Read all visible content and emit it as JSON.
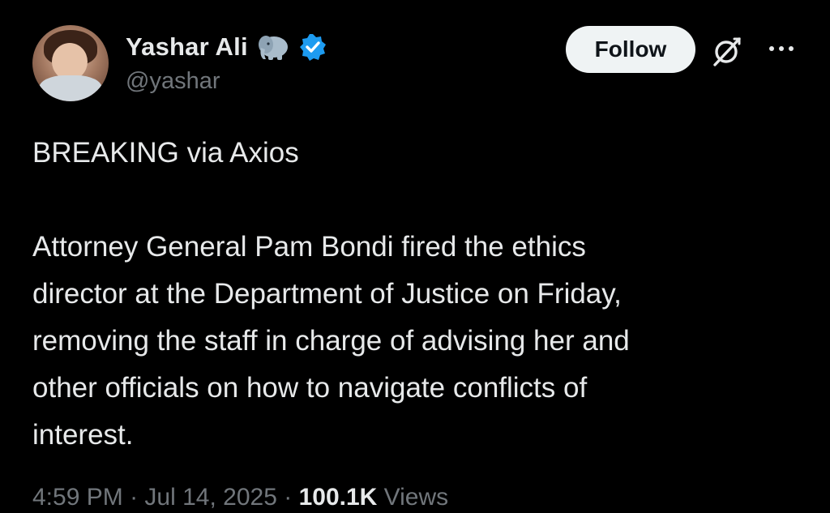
{
  "author": {
    "display_name": "Yashar Ali",
    "emoji": "elephant",
    "handle": "@yashar",
    "verified": true,
    "verified_color": "#1d9bf0"
  },
  "actions": {
    "follow_label": "Follow",
    "grok_icon": "grok-icon",
    "more_icon": "more-icon"
  },
  "tweet": {
    "text": "BREAKING via Axios\n\nAttorney General Pam Bondi fired the ethics\ndirector at the Department of Justice on Friday,\nremoving the staff in charge of advising her and\nother officials on how to navigate conflicts of\ninterest."
  },
  "meta": {
    "time": "4:59 PM",
    "date": "Jul 14, 2025",
    "separator": "·",
    "views_count": "100.1K",
    "views_label": "Views"
  },
  "colors": {
    "background": "#000000",
    "primary_text": "#e7e9ea",
    "secondary_text": "#71767b",
    "follow_bg": "#eff3f4",
    "follow_text": "#0f1419"
  }
}
